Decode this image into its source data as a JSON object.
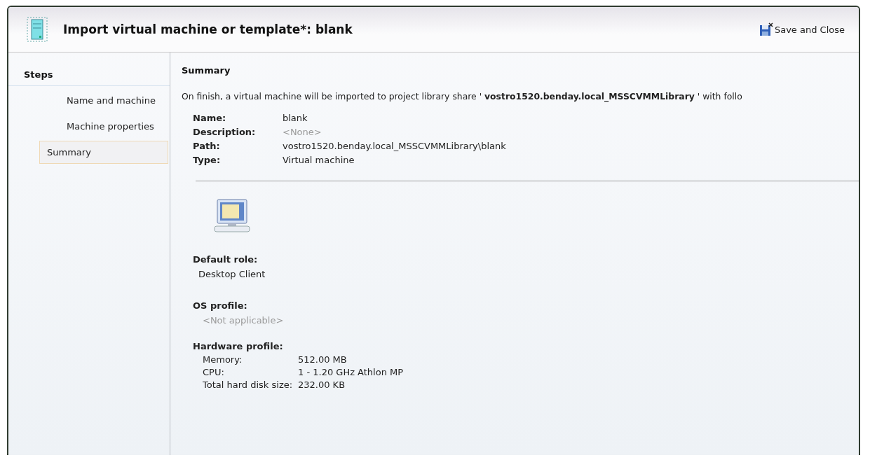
{
  "window": {
    "title": "Import virtual machine or template*: blank",
    "save_button": "Save and Close"
  },
  "steps": {
    "title": "Steps",
    "items": [
      {
        "label": "Name and machine",
        "selected": false
      },
      {
        "label": "Machine properties",
        "selected": false
      },
      {
        "label": "Summary",
        "selected": true
      }
    ]
  },
  "summary": {
    "title": "Summary",
    "intro": "On finish, a virtual machine will be imported to project library share ' **vostro1520.benday.local_MSSCVMMLibrary** ' with follo",
    "properties": [
      {
        "label": "Name:",
        "value": "blank",
        "muted": false
      },
      {
        "label": "Description:",
        "value": "<None>",
        "muted": true
      },
      {
        "label": "Path:",
        "value": "vostro1520.benday.local_MSSCVMMLibrary\\blank",
        "muted": false
      },
      {
        "label": "Type:",
        "value": "Virtual machine",
        "muted": false
      }
    ],
    "sections": [
      {
        "title": "Default role:",
        "value": "Desktop Client",
        "muted": false
      },
      {
        "title": "OS profile:",
        "value": "<Not applicable>",
        "muted": true
      }
    ],
    "hardware": {
      "title": "Hardware profile:",
      "rows": [
        {
          "label": "Memory:",
          "value": "512.00 MB"
        },
        {
          "label": "CPU:",
          "value": "1 - 1.20 GHz Athlon MP"
        },
        {
          "label": "Total hard disk size:",
          "value": "232.00 KB"
        }
      ]
    }
  }
}
